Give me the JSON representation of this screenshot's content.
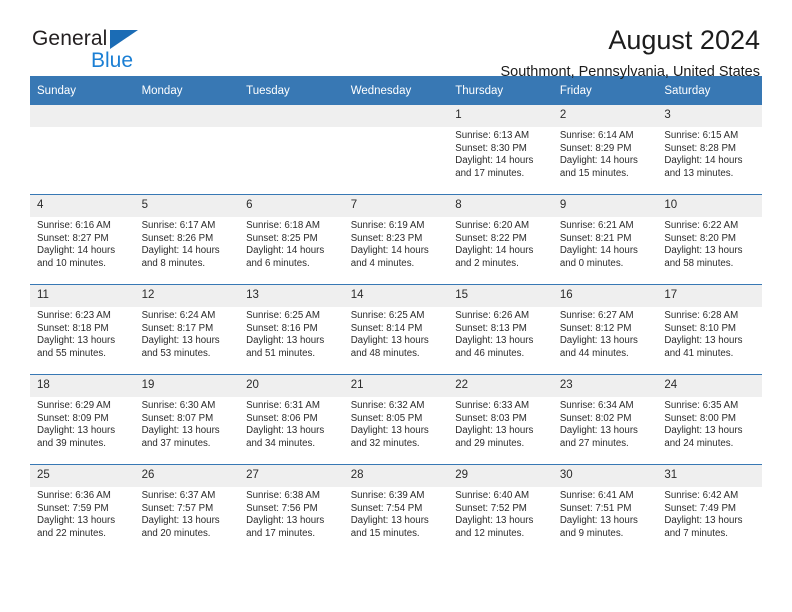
{
  "brand": {
    "name_top": "General",
    "name_bottom": "Blue",
    "triangle_color": "#1b6cb5",
    "bottom_color": "#1b7fd4"
  },
  "header": {
    "title": "August 2024",
    "subtitle": "Southmont, Pennsylvania, United States"
  },
  "theme": {
    "header_blue": "#3878b4",
    "daynum_band": "#efefef",
    "text": "#2b2b2b"
  },
  "labels": {
    "sunrise": "Sunrise:",
    "sunset": "Sunset:",
    "daylight": "Daylight:"
  },
  "weekdays": [
    "Sunday",
    "Monday",
    "Tuesday",
    "Wednesday",
    "Thursday",
    "Friday",
    "Saturday"
  ],
  "weeks": [
    [
      {
        "day": ""
      },
      {
        "day": ""
      },
      {
        "day": ""
      },
      {
        "day": ""
      },
      {
        "day": "1",
        "sunrise": "Sunrise: 6:13 AM",
        "sunset": "Sunset: 8:30 PM",
        "daylight_1": "Daylight: 14 hours",
        "daylight_2": "and 17 minutes."
      },
      {
        "day": "2",
        "sunrise": "Sunrise: 6:14 AM",
        "sunset": "Sunset: 8:29 PM",
        "daylight_1": "Daylight: 14 hours",
        "daylight_2": "and 15 minutes."
      },
      {
        "day": "3",
        "sunrise": "Sunrise: 6:15 AM",
        "sunset": "Sunset: 8:28 PM",
        "daylight_1": "Daylight: 14 hours",
        "daylight_2": "and 13 minutes."
      }
    ],
    [
      {
        "day": "4",
        "sunrise": "Sunrise: 6:16 AM",
        "sunset": "Sunset: 8:27 PM",
        "daylight_1": "Daylight: 14 hours",
        "daylight_2": "and 10 minutes."
      },
      {
        "day": "5",
        "sunrise": "Sunrise: 6:17 AM",
        "sunset": "Sunset: 8:26 PM",
        "daylight_1": "Daylight: 14 hours",
        "daylight_2": "and 8 minutes."
      },
      {
        "day": "6",
        "sunrise": "Sunrise: 6:18 AM",
        "sunset": "Sunset: 8:25 PM",
        "daylight_1": "Daylight: 14 hours",
        "daylight_2": "and 6 minutes."
      },
      {
        "day": "7",
        "sunrise": "Sunrise: 6:19 AM",
        "sunset": "Sunset: 8:23 PM",
        "daylight_1": "Daylight: 14 hours",
        "daylight_2": "and 4 minutes."
      },
      {
        "day": "8",
        "sunrise": "Sunrise: 6:20 AM",
        "sunset": "Sunset: 8:22 PM",
        "daylight_1": "Daylight: 14 hours",
        "daylight_2": "and 2 minutes."
      },
      {
        "day": "9",
        "sunrise": "Sunrise: 6:21 AM",
        "sunset": "Sunset: 8:21 PM",
        "daylight_1": "Daylight: 14 hours",
        "daylight_2": "and 0 minutes."
      },
      {
        "day": "10",
        "sunrise": "Sunrise: 6:22 AM",
        "sunset": "Sunset: 8:20 PM",
        "daylight_1": "Daylight: 13 hours",
        "daylight_2": "and 58 minutes."
      }
    ],
    [
      {
        "day": "11",
        "sunrise": "Sunrise: 6:23 AM",
        "sunset": "Sunset: 8:18 PM",
        "daylight_1": "Daylight: 13 hours",
        "daylight_2": "and 55 minutes."
      },
      {
        "day": "12",
        "sunrise": "Sunrise: 6:24 AM",
        "sunset": "Sunset: 8:17 PM",
        "daylight_1": "Daylight: 13 hours",
        "daylight_2": "and 53 minutes."
      },
      {
        "day": "13",
        "sunrise": "Sunrise: 6:25 AM",
        "sunset": "Sunset: 8:16 PM",
        "daylight_1": "Daylight: 13 hours",
        "daylight_2": "and 51 minutes."
      },
      {
        "day": "14",
        "sunrise": "Sunrise: 6:25 AM",
        "sunset": "Sunset: 8:14 PM",
        "daylight_1": "Daylight: 13 hours",
        "daylight_2": "and 48 minutes."
      },
      {
        "day": "15",
        "sunrise": "Sunrise: 6:26 AM",
        "sunset": "Sunset: 8:13 PM",
        "daylight_1": "Daylight: 13 hours",
        "daylight_2": "and 46 minutes."
      },
      {
        "day": "16",
        "sunrise": "Sunrise: 6:27 AM",
        "sunset": "Sunset: 8:12 PM",
        "daylight_1": "Daylight: 13 hours",
        "daylight_2": "and 44 minutes."
      },
      {
        "day": "17",
        "sunrise": "Sunrise: 6:28 AM",
        "sunset": "Sunset: 8:10 PM",
        "daylight_1": "Daylight: 13 hours",
        "daylight_2": "and 41 minutes."
      }
    ],
    [
      {
        "day": "18",
        "sunrise": "Sunrise: 6:29 AM",
        "sunset": "Sunset: 8:09 PM",
        "daylight_1": "Daylight: 13 hours",
        "daylight_2": "and 39 minutes."
      },
      {
        "day": "19",
        "sunrise": "Sunrise: 6:30 AM",
        "sunset": "Sunset: 8:07 PM",
        "daylight_1": "Daylight: 13 hours",
        "daylight_2": "and 37 minutes."
      },
      {
        "day": "20",
        "sunrise": "Sunrise: 6:31 AM",
        "sunset": "Sunset: 8:06 PM",
        "daylight_1": "Daylight: 13 hours",
        "daylight_2": "and 34 minutes."
      },
      {
        "day": "21",
        "sunrise": "Sunrise: 6:32 AM",
        "sunset": "Sunset: 8:05 PM",
        "daylight_1": "Daylight: 13 hours",
        "daylight_2": "and 32 minutes."
      },
      {
        "day": "22",
        "sunrise": "Sunrise: 6:33 AM",
        "sunset": "Sunset: 8:03 PM",
        "daylight_1": "Daylight: 13 hours",
        "daylight_2": "and 29 minutes."
      },
      {
        "day": "23",
        "sunrise": "Sunrise: 6:34 AM",
        "sunset": "Sunset: 8:02 PM",
        "daylight_1": "Daylight: 13 hours",
        "daylight_2": "and 27 minutes."
      },
      {
        "day": "24",
        "sunrise": "Sunrise: 6:35 AM",
        "sunset": "Sunset: 8:00 PM",
        "daylight_1": "Daylight: 13 hours",
        "daylight_2": "and 24 minutes."
      }
    ],
    [
      {
        "day": "25",
        "sunrise": "Sunrise: 6:36 AM",
        "sunset": "Sunset: 7:59 PM",
        "daylight_1": "Daylight: 13 hours",
        "daylight_2": "and 22 minutes."
      },
      {
        "day": "26",
        "sunrise": "Sunrise: 6:37 AM",
        "sunset": "Sunset: 7:57 PM",
        "daylight_1": "Daylight: 13 hours",
        "daylight_2": "and 20 minutes."
      },
      {
        "day": "27",
        "sunrise": "Sunrise: 6:38 AM",
        "sunset": "Sunset: 7:56 PM",
        "daylight_1": "Daylight: 13 hours",
        "daylight_2": "and 17 minutes."
      },
      {
        "day": "28",
        "sunrise": "Sunrise: 6:39 AM",
        "sunset": "Sunset: 7:54 PM",
        "daylight_1": "Daylight: 13 hours",
        "daylight_2": "and 15 minutes."
      },
      {
        "day": "29",
        "sunrise": "Sunrise: 6:40 AM",
        "sunset": "Sunset: 7:52 PM",
        "daylight_1": "Daylight: 13 hours",
        "daylight_2": "and 12 minutes."
      },
      {
        "day": "30",
        "sunrise": "Sunrise: 6:41 AM",
        "sunset": "Sunset: 7:51 PM",
        "daylight_1": "Daylight: 13 hours",
        "daylight_2": "and 9 minutes."
      },
      {
        "day": "31",
        "sunrise": "Sunrise: 6:42 AM",
        "sunset": "Sunset: 7:49 PM",
        "daylight_1": "Daylight: 13 hours",
        "daylight_2": "and 7 minutes."
      }
    ]
  ]
}
